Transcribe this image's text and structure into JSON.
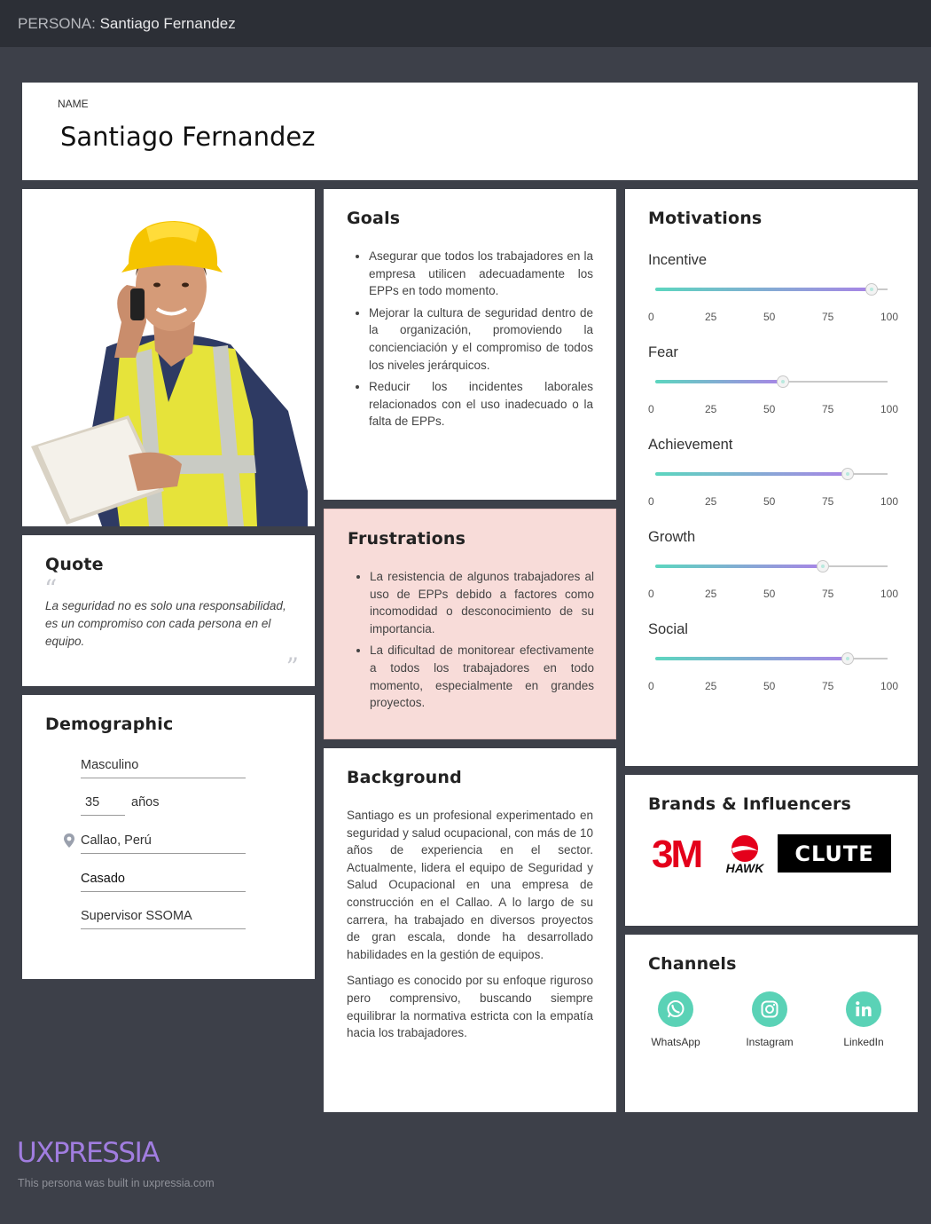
{
  "header": {
    "prefix": "PERSONA:",
    "title": "Santiago Fernandez"
  },
  "name_card": {
    "label": "NAME",
    "name": "Santiago Fernandez"
  },
  "quote": {
    "heading": "Quote",
    "text": " La seguridad no es solo una responsabilidad, es un compromiso con cada persona en el equipo."
  },
  "demographic": {
    "heading": "Demographic",
    "gender": "Masculino",
    "age": "35",
    "age_unit": "años",
    "location": "Callao, Perú",
    "status": "Casado",
    "role": "Supervisor SSOMA"
  },
  "goals": {
    "heading": "Goals",
    "items": [
      "Asegurar que todos los trabajadores en la empresa utilicen adecuadamente los EPPs en todo momento.",
      "Mejorar la cultura de seguridad dentro de la organización, promoviendo la concienciación y el compromiso de todos los niveles jerárquicos.",
      "Reducir los incidentes laborales relacionados con el uso inadecuado o la falta de EPPs."
    ]
  },
  "frustrations": {
    "heading": "Frustrations",
    "items": [
      "La resistencia de algunos trabajadores al uso de EPPs debido a factores como incomodidad o desconocimiento de su importancia.",
      "La dificultad de monitorear efectivamente a todos los trabajadores en todo momento, especialmente en grandes proyectos."
    ]
  },
  "background": {
    "heading": "Background",
    "paragraphs": [
      "Santiago es un profesional experimentado en seguridad y salud ocupacional, con más de 10 años de experiencia en el sector. Actualmente, lidera el equipo de Seguridad y Salud Ocupacional en una empresa de construcción en el Callao. A lo largo de su carrera, ha trabajado en diversos proyectos de gran escala, donde ha desarrollado habilidades en la gestión de equipos.",
      "Santiago es conocido por su enfoque riguroso pero comprensivo, buscando siempre equilibrar la normativa estricta con la empatía hacia los trabajadores."
    ]
  },
  "motivations": {
    "heading": "Motivations",
    "scale": [
      "0",
      "25",
      "50",
      "75",
      "100"
    ],
    "items": [
      {
        "label": "Incentive",
        "value": 93
      },
      {
        "label": "Fear",
        "value": 55
      },
      {
        "label": "Achievement",
        "value": 83
      },
      {
        "label": "Growth",
        "value": 72
      },
      {
        "label": "Social",
        "value": 83
      }
    ]
  },
  "brands": {
    "heading": "Brands & Influencers",
    "items": [
      {
        "name": "3M",
        "color": "#e4001b"
      },
      {
        "name": "HAWK",
        "color": "#e4001b"
      },
      {
        "name": "CLUTE",
        "color": "#000000"
      }
    ]
  },
  "channels": {
    "heading": "Channels",
    "items": [
      {
        "label": "WhatsApp",
        "icon": "whatsapp-icon"
      },
      {
        "label": "Instagram",
        "icon": "instagram-icon"
      },
      {
        "label": "LinkedIn",
        "icon": "linkedin-icon"
      }
    ]
  },
  "footer": {
    "logo": "UXPRESSIA",
    "note": "This persona was built in uxpressia.com"
  },
  "colors": {
    "accent_teal": "#5ad2b6",
    "accent_purple": "#a884e6",
    "frustration_bg": "#f8dcd9"
  }
}
